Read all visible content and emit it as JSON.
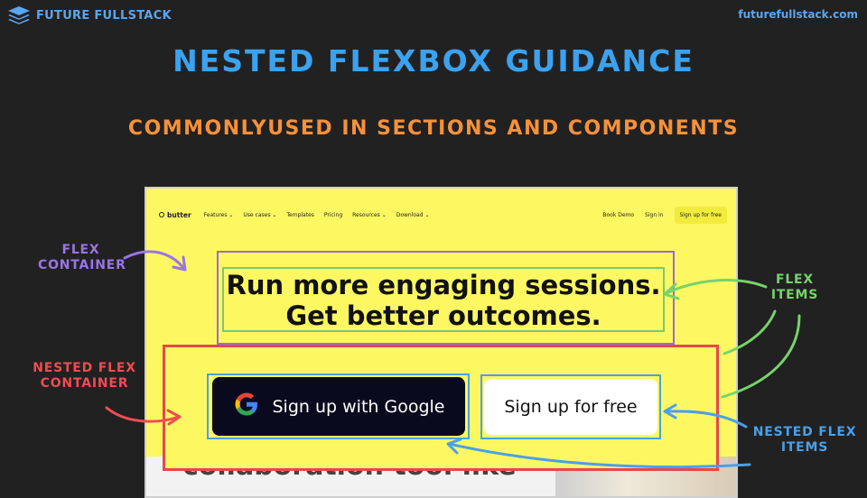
{
  "header": {
    "brand_name": "FUTURE FULLSTACK",
    "brand_icon": "layers-icon",
    "site_url": "futurefullstack.com"
  },
  "slide": {
    "title": "NESTED FLEXBOX GUIDANCE",
    "subtitle": "COMMONLYUSED IN SECTIONS AND COMPONENTS"
  },
  "screenshot": {
    "logo": "butter",
    "nav_items": [
      "Features ⌄",
      "Use cases ⌄",
      "Templates",
      "Pricing",
      "Resources ⌄",
      "Download ⌄"
    ],
    "nav_right": [
      "Book Demo",
      "Sign in"
    ],
    "nav_cta": "Sign up for free",
    "headline_line1": "Run more engaging sessions.",
    "headline_line2": "Get better outcomes.",
    "google_button": "Sign up with Google",
    "free_button": "Sign up for free",
    "partial_text_below": "collaboration tool like"
  },
  "callouts": {
    "flex_container": [
      "FLEX",
      "CONTAINER"
    ],
    "nested_flex_container": [
      "NESTED FLEX",
      "CONTAINER"
    ],
    "flex_items": [
      "FLEX",
      "ITEMS"
    ],
    "nested_flex_items": [
      "NESTED FLEX",
      "ITEMS"
    ]
  },
  "colors": {
    "background": "#212121",
    "title_blue": "#3aa2f0",
    "subtitle_orange": "#f5913a",
    "page_yellow": "#fdf861",
    "flex_container_purple": "#9c6bd6",
    "flex_items_green": "#7bc96f",
    "nested_container_red": "#e5484d",
    "nested_items_blue": "#4aa0e8"
  }
}
